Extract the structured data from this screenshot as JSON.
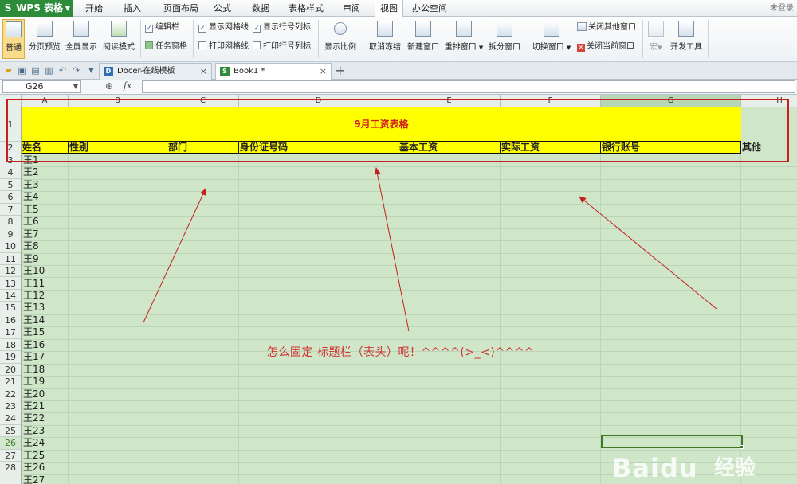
{
  "app": {
    "name": "WPS 表格",
    "logo_glyph": "S"
  },
  "menu": {
    "items": [
      "开始",
      "插入",
      "页面布局",
      "公式",
      "数据",
      "表格样式",
      "审阅",
      "视图",
      "办公空间"
    ],
    "active_index": 7,
    "login": "未登录"
  },
  "ribbon": {
    "views": [
      {
        "label": "普通",
        "selected": true
      },
      {
        "label": "分页预览"
      },
      {
        "label": "全屏显示"
      },
      {
        "label": "阅读模式"
      }
    ],
    "checks": {
      "edit_bar": {
        "label": "编辑栏",
        "checked": true
      },
      "task_pane": {
        "label": "任务窗格"
      },
      "show_gridlines": {
        "label": "显示网格线",
        "checked": true
      },
      "show_headings": {
        "label": "显示行号列标",
        "checked": true
      },
      "print_gridlines": {
        "label": "打印网格线",
        "checked": false
      },
      "print_headings": {
        "label": "打印行号列标",
        "checked": false
      }
    },
    "buttons": {
      "zoom": "显示比例",
      "unfreeze": "取消冻结",
      "new_window": "新建窗口",
      "arrange": "重排窗口",
      "split": "拆分窗口",
      "switch_window": "切换窗口",
      "close_others": "关闭其他窗口",
      "close_current": "关闭当前窗口",
      "macro": "宏",
      "dev_tools": "开发工具"
    }
  },
  "tabs": [
    {
      "label": "Docer-在线模板",
      "active": false
    },
    {
      "label": "Book1 *",
      "active": true
    }
  ],
  "formula_bar": {
    "cell_ref": "G26",
    "fx": "fx",
    "value": ""
  },
  "sheet": {
    "columns": [
      "A",
      "B",
      "C",
      "D",
      "E",
      "F",
      "G",
      "H"
    ],
    "selected_column": "G",
    "rows": [
      "1",
      "2",
      "3",
      "4",
      "5",
      "6",
      "7",
      "8",
      "9",
      "10",
      "11",
      "12",
      "13",
      "14",
      "15",
      "16",
      "17",
      "18",
      "19",
      "20",
      "21",
      "22",
      "23",
      "24",
      "25",
      "26",
      "27",
      "28"
    ],
    "selected_row": "26",
    "title": "9月工资表格",
    "headers": [
      "姓名",
      "性别",
      "部门",
      "身份证号码",
      "基本工资",
      "实际工资",
      "银行账号",
      "其他"
    ],
    "names": [
      "王1",
      "王2",
      "王3",
      "王4",
      "王5",
      "王6",
      "王7",
      "王8",
      "王9",
      "王10",
      "王11",
      "王12",
      "王13",
      "王14",
      "王15",
      "王16",
      "王17",
      "王18",
      "王19",
      "王20",
      "王21",
      "王22",
      "王23",
      "王24",
      "王25",
      "王26",
      "王27"
    ]
  },
  "annotation": "怎么固定 标题栏（表头）呢！^^^^(>_<)^^^^",
  "watermark": {
    "text": "Baidu",
    "cn": "经验"
  },
  "colors": {
    "accent_red": "#d23030",
    "header_yellow": "#ffff00",
    "wps_green": "#2e8b3a",
    "selection_green": "#3a7a22"
  }
}
